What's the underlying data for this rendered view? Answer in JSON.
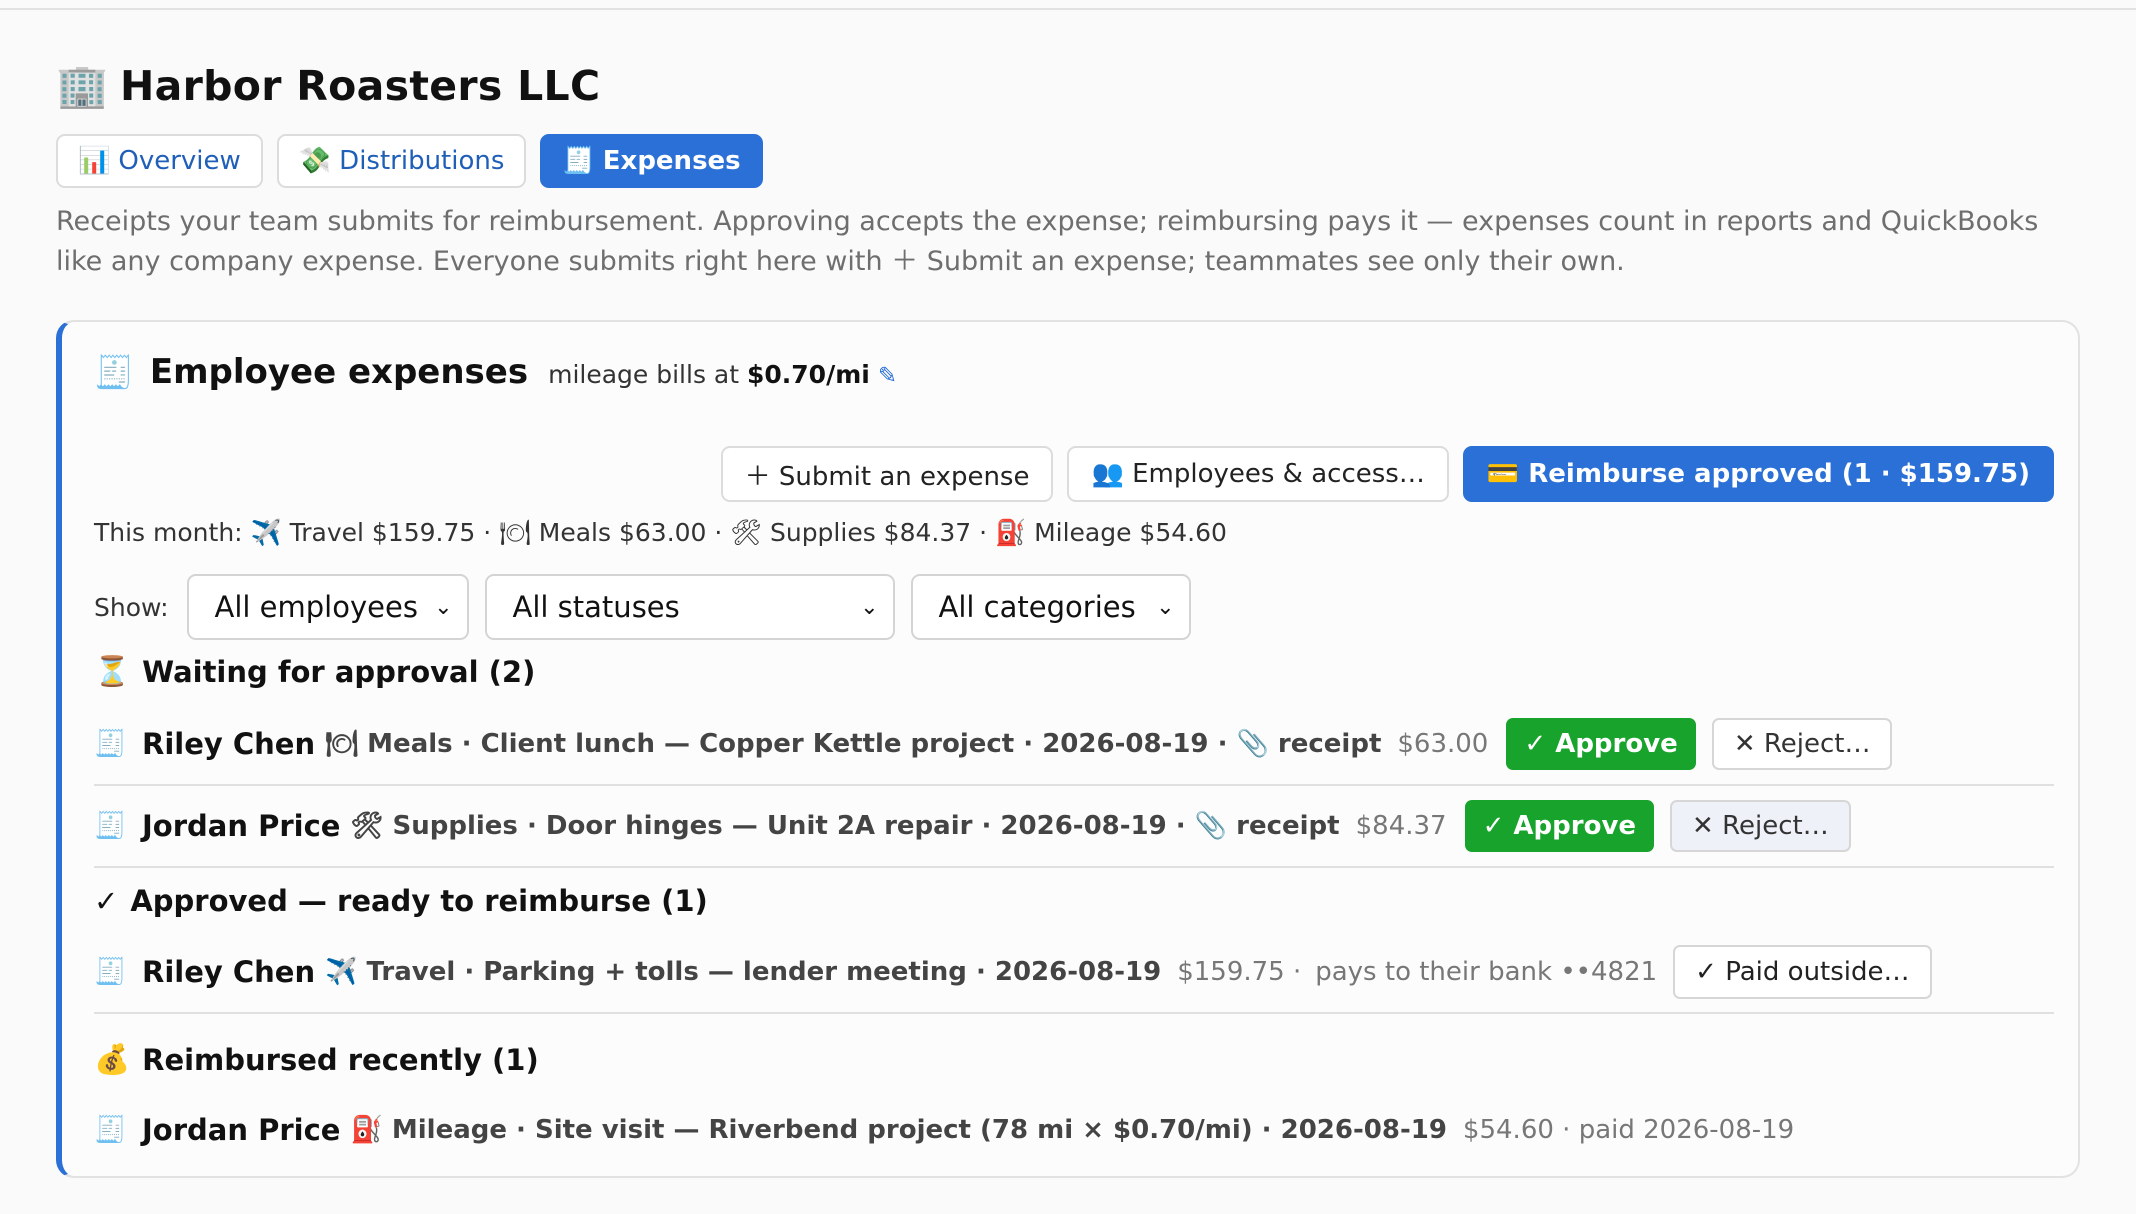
{
  "company": {
    "icon": "🏢",
    "name": "Harbor Roasters LLC"
  },
  "tabs": [
    {
      "icon": "📊",
      "label": "Overview"
    },
    {
      "icon": "💸",
      "label": "Distributions"
    },
    {
      "icon": "🧾",
      "label": "Expenses",
      "active": true
    }
  ],
  "intro": "Receipts your team submits for reimbursement. Approving accepts the expense; reimbursing pays it — expenses count in reports and QuickBooks like any company expense. Everyone submits right here with ＋ Submit an expense; teammates see only their own.",
  "card": {
    "icon": "🧾",
    "title": "Employee expenses",
    "mileage_prefix": "mileage bills at",
    "mileage_rate": "$0.70/mi",
    "edit_icon": "✎",
    "actions": {
      "submit": "＋ Submit an expense",
      "employees": "👥 Employees & access…",
      "reimburse": "💳 Reimburse approved (1 · $159.75)"
    },
    "month_summary": "This month: ✈️ Travel $159.75 · 🍽 Meals $63.00 · 🛠 Supplies $84.37 · ⛽ Mileage $54.60",
    "filters": {
      "label": "Show:",
      "employee": "All employees",
      "status": "All statuses",
      "category": "All categories"
    },
    "sections": {
      "waiting": {
        "icon": "⏳",
        "title": "Waiting for approval (2)"
      },
      "approved": {
        "icon": "✓",
        "title": "Approved — ready to reimburse (1)"
      },
      "reimbursed": {
        "icon": "💰",
        "title": "Reimbursed recently (1)"
      }
    },
    "rows": {
      "w1": {
        "icon": "🧾",
        "name": "Riley Chen",
        "details": "🍽 Meals · Client lunch — Copper Kettle project · 2026-08-19 · 📎 receipt",
        "amount": "$63.00",
        "approve": "✓ Approve",
        "reject": "✕ Reject…"
      },
      "w2": {
        "icon": "🧾",
        "name": "Jordan Price",
        "details": "🛠 Supplies · Door hinges — Unit 2A repair · 2026-08-19 · 📎 receipt",
        "amount": "$84.37",
        "approve": "✓ Approve",
        "reject": "✕ Reject…"
      },
      "a1": {
        "icon": "🧾",
        "name": "Riley Chen",
        "details": "✈️ Travel · Parking + tolls — lender meeting · 2026-08-19",
        "amount": "$159.75 ·",
        "extra": "pays to their bank ••4821",
        "paid_outside": "✓ Paid outside…"
      },
      "r1": {
        "icon": "🧾",
        "name": "Jordan Price",
        "details": "⛽ Mileage · Site visit — Riverbend project (78 mi × $0.70/mi) · 2026-08-19",
        "amount": "$54.60 · paid 2026-08-19"
      }
    }
  }
}
